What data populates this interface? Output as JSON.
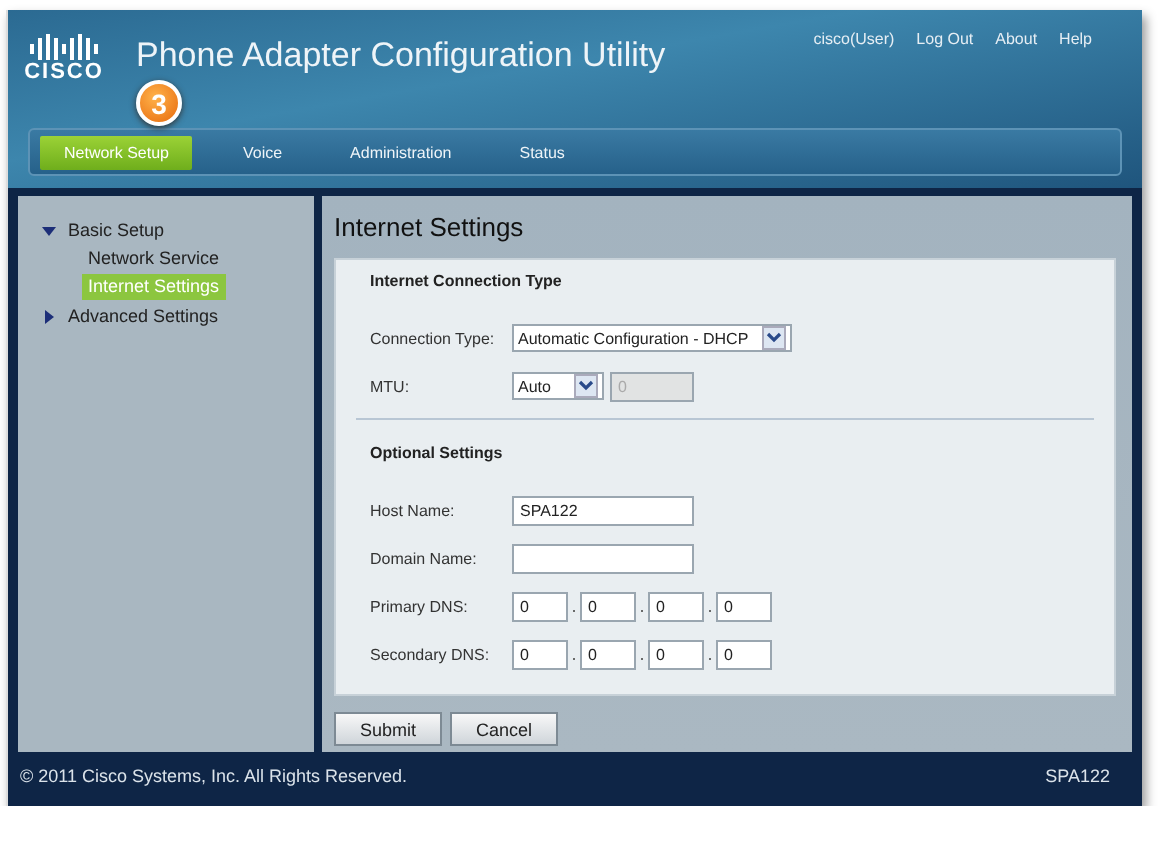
{
  "header": {
    "logo_text": "CISCO",
    "title": "Phone Adapter Configuration Utility",
    "user_links": [
      {
        "label": "cisco(User)"
      },
      {
        "label": "Log Out"
      },
      {
        "label": "About"
      },
      {
        "label": "Help"
      }
    ],
    "callout": "3"
  },
  "tabs": [
    {
      "label": "Network Setup",
      "selected": true
    },
    {
      "label": "Voice",
      "selected": false
    },
    {
      "label": "Administration",
      "selected": false
    },
    {
      "label": "Status",
      "selected": false
    }
  ],
  "sidebar": {
    "items": [
      {
        "label": "Basic Setup",
        "expanded": true,
        "children": [
          {
            "label": "Network Service",
            "selected": false
          },
          {
            "label": "Internet Settings",
            "selected": true
          }
        ]
      },
      {
        "label": "Advanced Settings",
        "expanded": false
      }
    ]
  },
  "page_title": "Internet Settings",
  "sections": [
    {
      "title": "Internet Connection Type",
      "fields": [
        {
          "kind": "select",
          "label": "Connection Type:",
          "value": "Automatic Configuration - DHCP"
        },
        {
          "kind": "select_input",
          "label": "MTU:",
          "value": "Auto",
          "input_value": "0",
          "input_disabled": true
        }
      ]
    },
    {
      "title": "Optional Settings",
      "fields": [
        {
          "kind": "text",
          "label": "Host Name:",
          "value": "SPA122"
        },
        {
          "kind": "text",
          "label": "Domain Name:"
        },
        {
          "kind": "ip",
          "label": "Primary DNS:",
          "separator": ".",
          "octets": [
            "0",
            "0",
            "0",
            "0"
          ]
        },
        {
          "kind": "ip",
          "label": "Secondary DNS:",
          "separator": ".",
          "octets": [
            "0",
            "0",
            "0",
            "0"
          ]
        }
      ]
    }
  ],
  "buttons": [
    {
      "label": "Submit"
    },
    {
      "label": "Cancel"
    }
  ],
  "footer": {
    "copyright": "© 2011 Cisco Systems, Inc. All Rights Reserved.",
    "model": "SPA122"
  }
}
